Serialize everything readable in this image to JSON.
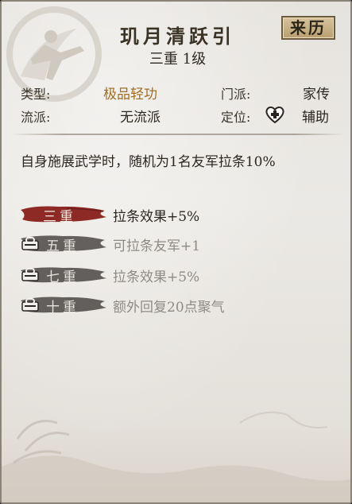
{
  "skill": {
    "name": "玑月清跃引",
    "origin_button": "来历",
    "level": "三重 1级"
  },
  "attributes": {
    "type_label": "类型:",
    "type_value": "极品轻功",
    "sect_label": "门派:",
    "sect_value": "家传",
    "school_label": "流派:",
    "school_value": "无流派",
    "role_label": "定位:",
    "role_value": "辅助",
    "role_icon": "heart-plus-icon"
  },
  "description": "自身施展武学时，随机为1名友军拉条10%",
  "tiers": [
    {
      "label": "三重",
      "effect": "拉条效果+5%",
      "unlocked": true
    },
    {
      "label": "五重",
      "effect": "可拉条友军+1",
      "unlocked": false
    },
    {
      "label": "七重",
      "effect": "拉条效果+5%",
      "unlocked": false
    },
    {
      "label": "十重",
      "effect": "额外回复20点聚气",
      "unlocked": false
    }
  ],
  "colors": {
    "active_brush": "#8e2a25",
    "locked_brush": "#4a4744",
    "gold_text": "#a06d22"
  }
}
